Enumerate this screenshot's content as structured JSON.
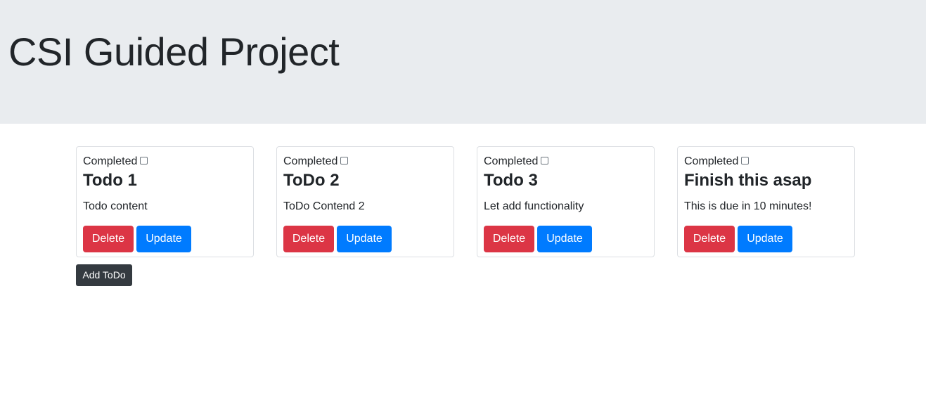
{
  "header": {
    "title": "CSI Guided Project"
  },
  "todos": [
    {
      "completed_label": "Completed",
      "completed": false,
      "title": "Todo 1",
      "content": "Todo content",
      "delete_label": "Delete",
      "update_label": "Update"
    },
    {
      "completed_label": "Completed",
      "completed": false,
      "title": "ToDo 2",
      "content": "ToDo Contend 2",
      "delete_label": "Delete",
      "update_label": "Update"
    },
    {
      "completed_label": "Completed",
      "completed": false,
      "title": "Todo 3",
      "content": "Let add functionality",
      "delete_label": "Delete",
      "update_label": "Update"
    },
    {
      "completed_label": "Completed",
      "completed": false,
      "title": "Finish this asap",
      "content": "This is due in 10 minutes!",
      "delete_label": "Delete",
      "update_label": "Update"
    }
  ],
  "actions": {
    "add_label": "Add ToDo"
  },
  "colors": {
    "jumbotron": "#e9ecef",
    "danger": "#dc3545",
    "primary": "#007bff",
    "dark": "#343a40"
  }
}
